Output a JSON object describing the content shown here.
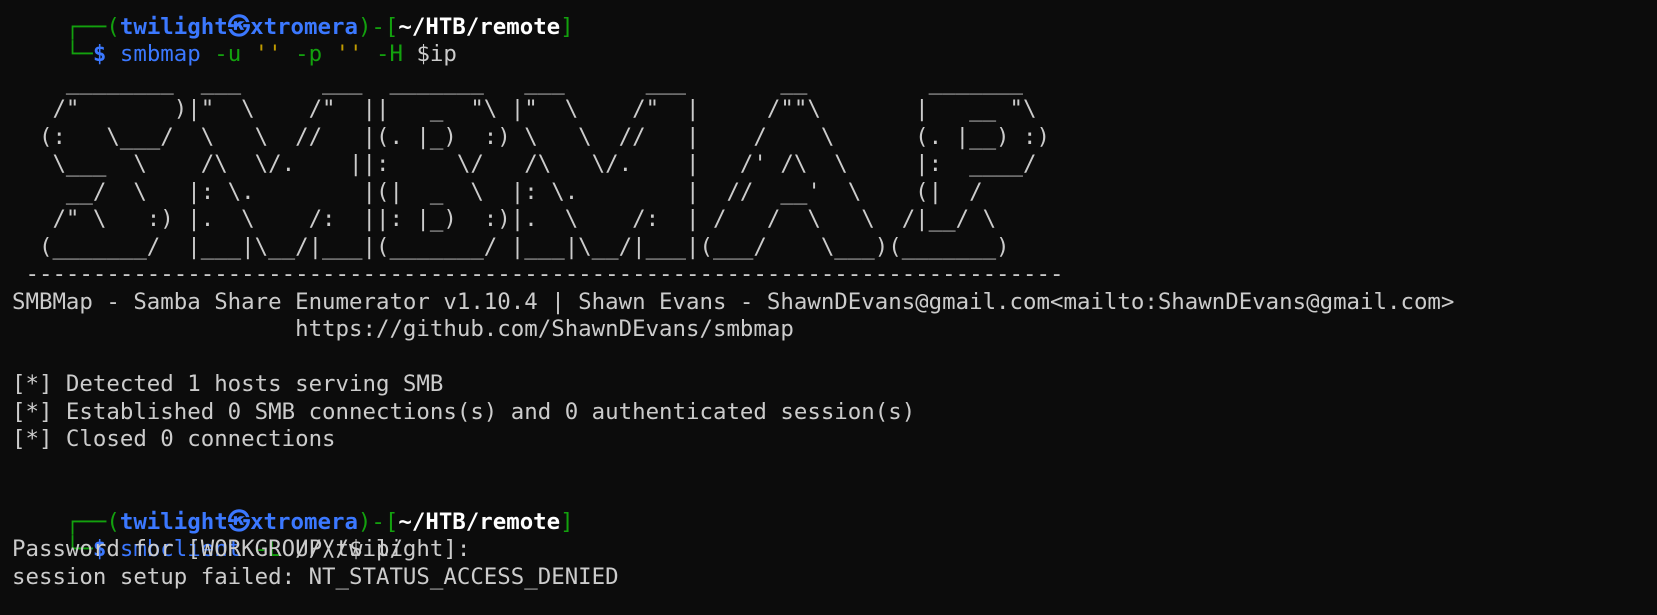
{
  "prompts": [
    {
      "corner_top": "┌──",
      "user": "twilight",
      "skull": "㉿",
      "host": "xtromera",
      "mid": ")-[",
      "path": "~/HTB/remote",
      "close": "]"
    },
    {
      "corner_top": "┌──(",
      "user": "twilight",
      "skull": "㉿",
      "host": "xtromera",
      "mid": ")-[",
      "path": "~/HTB/remote",
      "close": "]"
    }
  ],
  "commands": [
    {
      "corner": "└─",
      "dollar": "$ ",
      "program": "smbmap",
      "args": [
        {
          "text": " -u ",
          "kind": "flag"
        },
        {
          "text": "''",
          "kind": "str"
        },
        {
          "text": " -p ",
          "kind": "flag"
        },
        {
          "text": "''",
          "kind": "str"
        },
        {
          "text": " -H ",
          "kind": "flag"
        },
        {
          "text": "$ip",
          "kind": "var"
        }
      ]
    },
    {
      "corner": "└─",
      "dollar": "$ ",
      "program": "smbclient",
      "args": [
        {
          "text": " -L ",
          "kind": "flag"
        },
        {
          "text": "////$ip/",
          "kind": "var"
        }
      ]
    }
  ],
  "banner": [
    "    ________  ___      ___  _______   ___      ___       __         _______",
    "   /\"       )|\"  \\    /\"  ||   _  \"\\ |\"  \\    /\"  |     /\"\"\\       |   __ \"\\",
    "  (:   \\___/  \\   \\  //   |(. |_)  :) \\   \\  //   |    /    \\      (. |__) :)",
    "   \\___  \\    /\\  \\/.    ||:     \\/   /\\   \\/.    |   /' /\\  \\     |:  ____/",
    "    __/  \\   |: \\.        |(|  _  \\  |: \\.        |  //  __'  \\    (|  /",
    "   /\" \\   :) |.  \\    /:  ||: |_)  :)|.  \\    /:  | /   /  \\   \\  /|__/ \\",
    "  (_______/  |___|\\__/|___|(_______/ |___|\\__/|___|(___/    \\___)(_______)",
    " -----------------------------------------------------------------------------"
  ],
  "output_smbmap": [
    "SMBMap - Samba Share Enumerator v1.10.4 | Shawn Evans - ShawnDEvans@gmail.com<mailto:ShawnDEvans@gmail.com>",
    "                     https://github.com/ShawnDEvans/smbmap",
    "",
    "[*] Detected 1 hosts serving SMB",
    "[*] Established 0 SMB connections(s) and 0 authenticated session(s)",
    "[*] Closed 0 connections"
  ],
  "output_smbclient": [
    "Password for [WORKGROUP\\twilight]:",
    "session setup failed: NT_STATUS_ACCESS_DENIED"
  ],
  "colors": {
    "background": "#0c0c0c",
    "text": "#cccccc",
    "prompt_green": "#13a10e",
    "prompt_blue": "#3b78ff",
    "string_yellow": "#c19c00"
  }
}
